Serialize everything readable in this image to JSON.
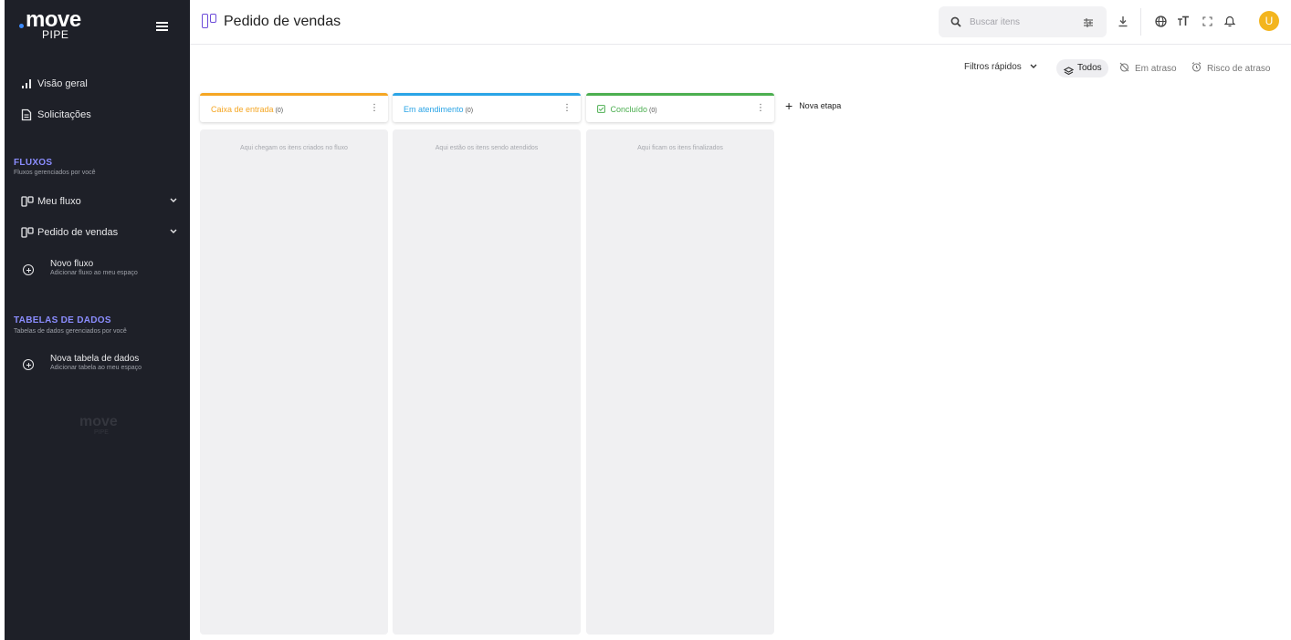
{
  "brand": {
    "name": "move",
    "sub": "PIPE"
  },
  "sidebar": {
    "nav": [
      {
        "label": "Visão geral",
        "icon": "bar-chart-icon"
      },
      {
        "label": "Solicitações",
        "icon": "document-icon"
      }
    ],
    "flows_section": {
      "title": "FLUXOS",
      "subtitle": "Fluxos gerenciados por você"
    },
    "flows": [
      {
        "label": "Meu fluxo",
        "icon": "kanban-icon"
      },
      {
        "label": "Pedido de vendas",
        "icon": "kanban-icon"
      }
    ],
    "new_flow": {
      "title": "Novo fluxo",
      "subtitle": "Adicionar fluxo ao meu espaço"
    },
    "tables_section": {
      "title": "TABELAS DE DADOS",
      "subtitle": "Tabelas de dados gerenciados por você"
    },
    "new_table": {
      "title": "Nova tabela de dados",
      "subtitle": "Adicionar tabela ao meu espaço"
    },
    "watermark": {
      "name": "move",
      "sub": "PIPE"
    }
  },
  "header": {
    "title": "Pedido de vendas",
    "search_placeholder": "Buscar itens",
    "avatar_initial": "U"
  },
  "filters": {
    "quick_label": "Filtros rápidos",
    "all_label": "Todos",
    "late_label": "Em atraso",
    "risk_label": "Risco de atraso"
  },
  "board": {
    "columns": [
      {
        "title": "Caixa de entrada",
        "count": "(0)",
        "empty_text": "Aqui chegam os itens criados no fluxo",
        "color": "#f5a623"
      },
      {
        "title": "Em atendimento",
        "count": "(0)",
        "empty_text": "Aqui estão os itens sendo atendidos",
        "color": "#2aa4e6"
      },
      {
        "title": "Concluído",
        "count": "(0)",
        "empty_text": "Aqui ficam os itens finalizados",
        "color": "#4caf50"
      }
    ],
    "new_stage_label": "Nova etapa"
  },
  "colors": {
    "sidebar_bg": "#1e2028",
    "section_accent": "#8b8dff",
    "brand_accent": "#6c4cd9",
    "avatar": "#f3b51e"
  }
}
